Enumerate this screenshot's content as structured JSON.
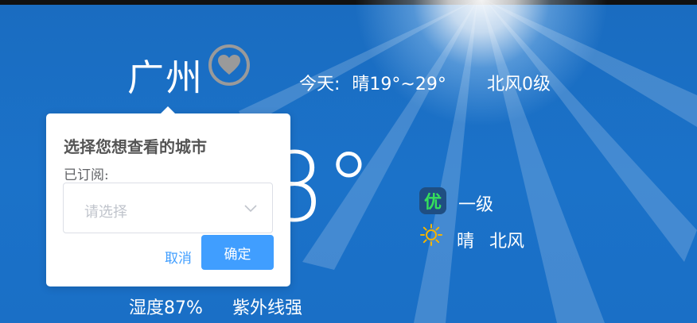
{
  "city": {
    "name": "广州"
  },
  "today": {
    "label": "今天:",
    "weather": "晴19°~29°",
    "wind": "北风0级"
  },
  "current": {
    "temp": "8°",
    "aqi_badge": "优",
    "aqi_level": "一级",
    "condition": "晴",
    "wind": "北风",
    "humidity": "湿度87%",
    "uv": "紫外线强"
  },
  "popover": {
    "title": "选择您想查看的城市",
    "subscribed_label": "已订阅:",
    "select_placeholder": "请选择",
    "cancel_label": "取消",
    "confirm_label": "确定"
  },
  "colors": {
    "accent": "#409eff",
    "background": "#1b72c9",
    "aqi_good": "#35e05b"
  },
  "icons": {
    "favorite": "heart-icon",
    "weather": "sun-icon",
    "dropdown": "chevron-down-icon"
  }
}
